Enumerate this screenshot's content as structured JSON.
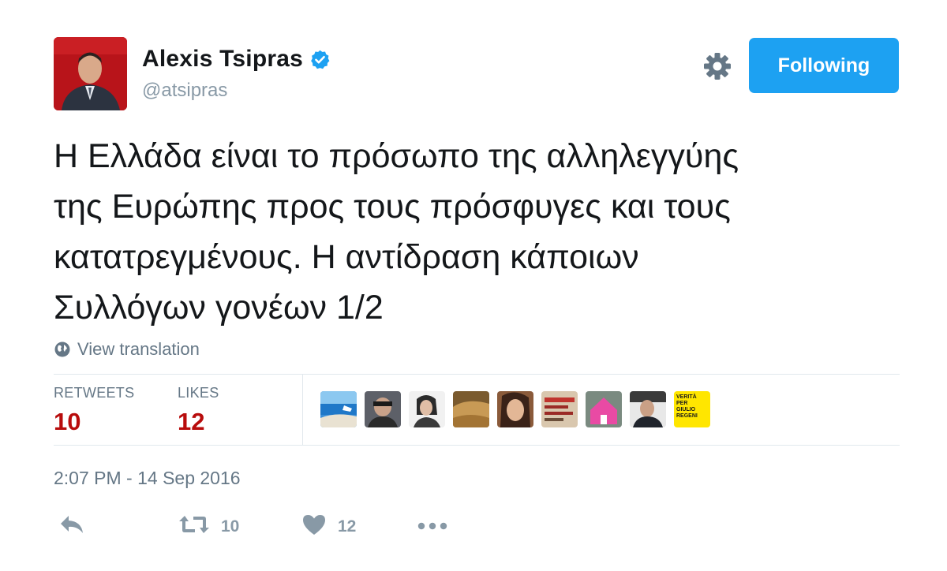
{
  "user": {
    "name": "Alexis Tsipras",
    "handle": "@atsipras",
    "verified": true,
    "avatar_icon": "profile-photo"
  },
  "header": {
    "follow_label": "Following",
    "settings_icon": "gear-icon"
  },
  "tweet": {
    "lines": [
      "Η Ελλάδα είναι το πρόσωπο της αλληλεγγύης",
      "της Ευρώπης προς τους πρόσφυγες και τους",
      "κατατρεγμένους. Η αντίδραση κάποιων",
      "Συλλόγων γονέων 1/2"
    ],
    "translate_label": "View translation"
  },
  "stats": {
    "retweets_label": "RETWEETS",
    "retweets_count": "10",
    "likes_label": "LIKES",
    "likes_count": "12"
  },
  "likers": [
    {
      "icon": "beach-photo"
    },
    {
      "icon": "person-photo"
    },
    {
      "icon": "person-photo"
    },
    {
      "icon": "landscape-photo"
    },
    {
      "icon": "person-photo"
    },
    {
      "icon": "poster-photo"
    },
    {
      "icon": "house-photo"
    },
    {
      "icon": "person-photo"
    },
    {
      "icon": "text-logo",
      "text": "VERITÀ PER GIULIO REGENI"
    }
  ],
  "timestamp": "2:07 PM - 14 Sep 2016",
  "actions": {
    "reply_icon": "reply-icon",
    "retweet_icon": "retweet-icon",
    "retweet_count": "10",
    "like_icon": "heart-icon",
    "like_count": "12",
    "more_icon": "more-icon"
  },
  "colors": {
    "accent": "#1da1f2",
    "stat_value": "#b80c0c",
    "muted": "#657786",
    "icon_gray": "#8899a6"
  }
}
